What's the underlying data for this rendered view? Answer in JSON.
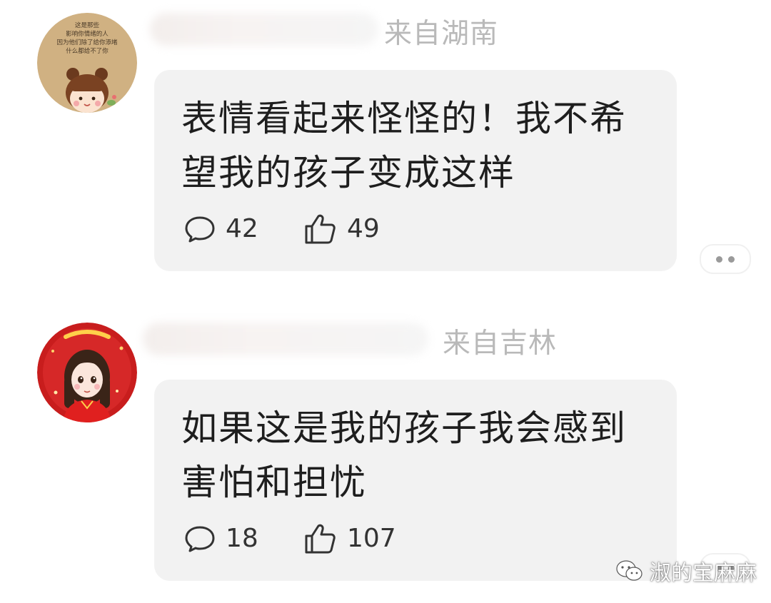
{
  "comments": [
    {
      "location": "来自湖南",
      "text": "表情看起来怪怪的！我不希望我的孩子变成这样",
      "reply_count": "42",
      "like_count": "49",
      "avatar_text": [
        "这是那些",
        "影响你情绪的人",
        "因为他们除了给你添堵",
        "什么都给不了你"
      ]
    },
    {
      "location": "来自吉林",
      "text": "如果这是我的孩子我会感到害怕和担忧",
      "reply_count": "18",
      "like_count": "107"
    }
  ],
  "watermark": {
    "label": "淑的宝麻麻",
    "icon": "wechat-icon"
  },
  "icons": {
    "reply": "comment-bubble-icon",
    "like": "thumbs-up-icon",
    "more": "more-dots-icon"
  },
  "colors": {
    "bubble_bg": "#f2f2f2",
    "location_text": "#b9b9b9",
    "body_text": "#1e1e1e"
  }
}
